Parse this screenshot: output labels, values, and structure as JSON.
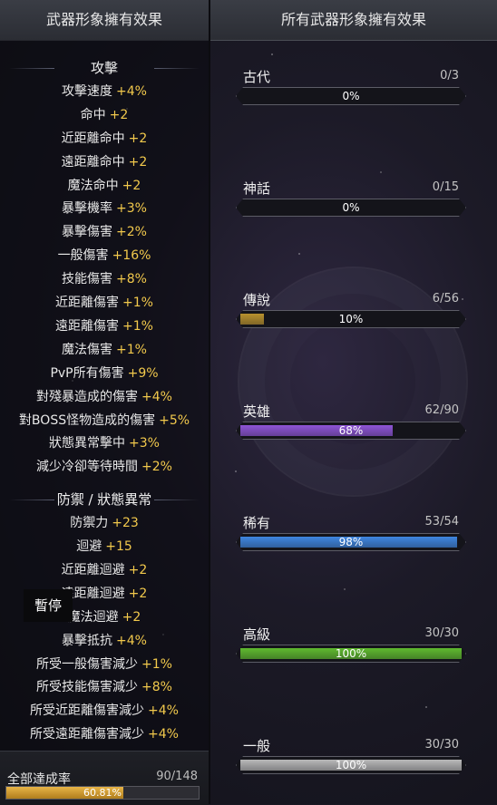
{
  "headers": {
    "left": "武器形象擁有效果",
    "right": "所有武器形象擁有效果"
  },
  "sections": [
    {
      "title": "攻擊",
      "stats": [
        {
          "name": "攻擊速度",
          "value": "+4%"
        },
        {
          "name": "命中",
          "value": "+2"
        },
        {
          "name": "近距離命中",
          "value": "+2"
        },
        {
          "name": "遠距離命中",
          "value": "+2"
        },
        {
          "name": "魔法命中",
          "value": "+2"
        },
        {
          "name": "暴擊機率",
          "value": "+3%"
        },
        {
          "name": "暴擊傷害",
          "value": "+2%"
        },
        {
          "name": "一般傷害",
          "value": "+16%"
        },
        {
          "name": "技能傷害",
          "value": "+8%"
        },
        {
          "name": "近距離傷害",
          "value": "+1%"
        },
        {
          "name": "遠距離傷害",
          "value": "+1%"
        },
        {
          "name": "魔法傷害",
          "value": "+1%"
        },
        {
          "name": "PvP所有傷害",
          "value": "+9%"
        },
        {
          "name": "對殘暴造成的傷害",
          "value": "+4%"
        },
        {
          "name": "對BOSS怪物造成的傷害",
          "value": "+5%"
        },
        {
          "name": "狀態異常擊中",
          "value": "+3%"
        },
        {
          "name": "減少冷卻等待時間",
          "value": "+2%"
        }
      ]
    },
    {
      "title": "防禦 / 狀態異常",
      "stats": [
        {
          "name": "防禦力",
          "value": "+23"
        },
        {
          "name": "迴避",
          "value": "+15"
        },
        {
          "name": "近距離迴避",
          "value": "+2"
        },
        {
          "name": "遠距離迴避",
          "value": "+2"
        },
        {
          "name": "魔法迴避",
          "value": "+2"
        },
        {
          "name": "暴擊抵抗",
          "value": "+4%"
        },
        {
          "name": "所受一般傷害減少",
          "value": "+1%"
        },
        {
          "name": "所受技能傷害減少",
          "value": "+8%"
        },
        {
          "name": "所受近距離傷害減少",
          "value": "+4%"
        },
        {
          "name": "所受遠距離傷害減少",
          "value": "+4%"
        }
      ]
    }
  ],
  "overlay": {
    "pause_label": "暫停"
  },
  "footer": {
    "label": "全部達成率",
    "count": "90/148",
    "percent_text": "60.81%",
    "fraction": 0.6081
  },
  "grades": [
    {
      "name": "古代",
      "count": "0/3",
      "percent_text": "0%",
      "fraction": 0.0,
      "color": "#888888"
    },
    {
      "name": "神話",
      "count": "0/15",
      "percent_text": "0%",
      "fraction": 0.0,
      "color": "#888888"
    },
    {
      "name": "傳說",
      "count": "6/56",
      "percent_text": "10%",
      "fraction": 0.107,
      "color": "#b8912e"
    },
    {
      "name": "英雄",
      "count": "62/90",
      "percent_text": "68%",
      "fraction": 0.689,
      "color": "#8e55d6"
    },
    {
      "name": "稀有",
      "count": "53/54",
      "percent_text": "98%",
      "fraction": 0.981,
      "color": "#3f86e0"
    },
    {
      "name": "高級",
      "count": "30/30",
      "percent_text": "100%",
      "fraction": 1.0,
      "color": "#5fba2f"
    },
    {
      "name": "一般",
      "count": "30/30",
      "percent_text": "100%",
      "fraction": 1.0,
      "color": "#b9b9b9"
    }
  ]
}
